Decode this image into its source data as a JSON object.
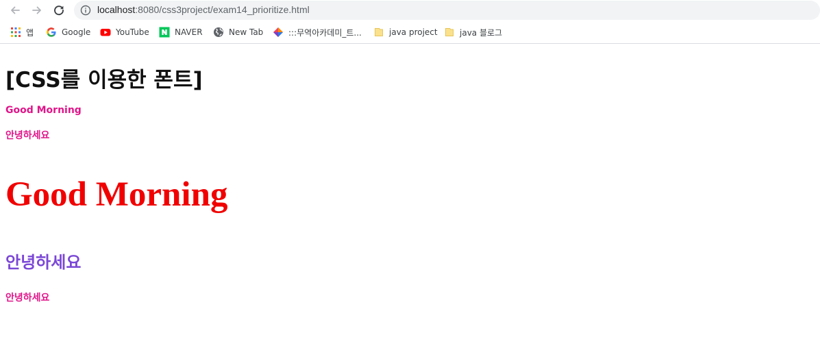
{
  "browser": {
    "url_host": "localhost",
    "url_rest": ":8080/css3project/exam14_prioritize.html",
    "bookmarks": [
      {
        "label": "앱",
        "icon": "apps-grid-icon"
      },
      {
        "label": "Google",
        "icon": "google-icon"
      },
      {
        "label": "YouTube",
        "icon": "youtube-icon"
      },
      {
        "label": "NAVER",
        "icon": "naver-icon"
      },
      {
        "label": "New Tab",
        "icon": "globe-icon"
      },
      {
        "label": ":::무역아카데미_트...",
        "icon": "diamond-logo-icon"
      },
      {
        "label": "java project",
        "icon": "folder-icon"
      },
      {
        "label": "java 블로그",
        "icon": "folder-icon"
      }
    ]
  },
  "page": {
    "heading": "[CSS를 이용한 폰트]",
    "line1": "Good Morning",
    "line2": "안녕하세요",
    "big_text": "Good Morning",
    "purple_heading": "안녕하세요",
    "line3": "안녕하세요"
  },
  "colors": {
    "pink": "#e0158a",
    "red": "#f00000",
    "purple": "#7b47d6"
  }
}
